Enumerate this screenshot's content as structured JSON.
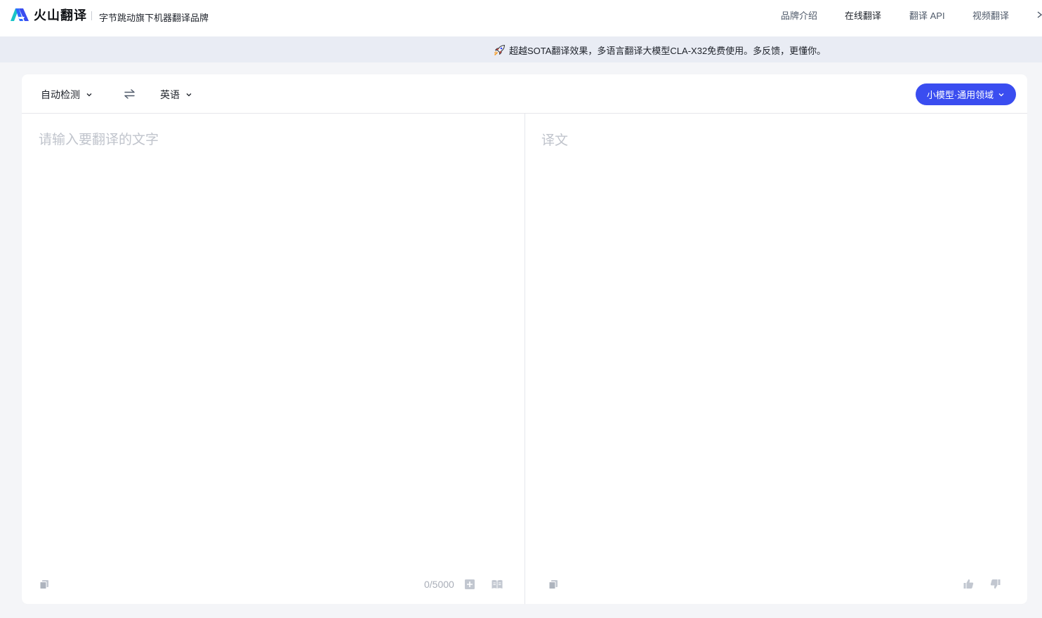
{
  "header": {
    "logo_text": "火山翻译",
    "slogan": "字节跳动旗下机器翻译品牌",
    "nav": [
      {
        "label": "品牌介绍",
        "active": false
      },
      {
        "label": "在线翻译",
        "active": true
      },
      {
        "label": "翻译 API",
        "active": false
      },
      {
        "label": "视频翻译",
        "active": false
      }
    ]
  },
  "banner": {
    "icon": "rocket-icon",
    "text": "超越SOTA翻译效果，多语言翻译大模型CLA-X32免费使用。多反馈，更懂你。"
  },
  "translator": {
    "source_lang": "自动检测",
    "target_lang": "英语",
    "model_label": "小模型·通用领域",
    "source_placeholder": "请输入要翻译的文字",
    "source_value": "",
    "target_placeholder": "译文",
    "char_count": "0/5000"
  },
  "colors": {
    "accent": "#3a4df0",
    "page_bg": "#f4f5f8",
    "banner_bg": "#e9ecf4",
    "placeholder": "#c0c4cc",
    "icon_gray": "#c2c7d0"
  }
}
